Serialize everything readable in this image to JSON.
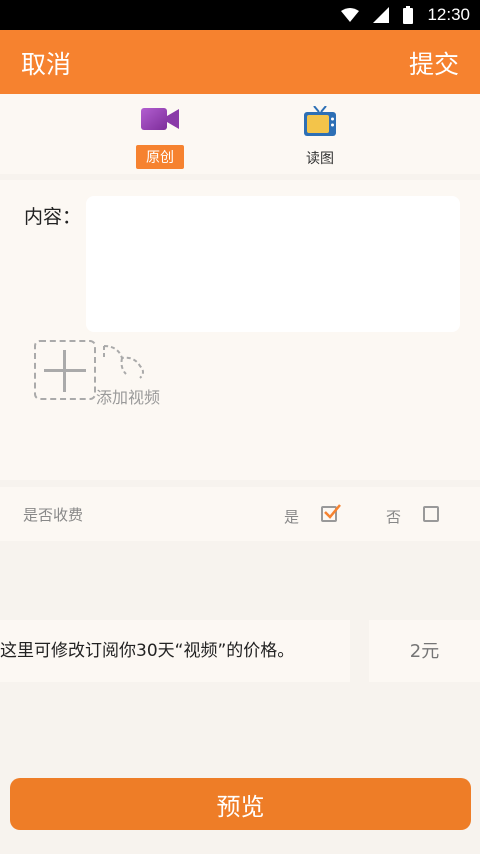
{
  "status_bar": {
    "time": "12:30"
  },
  "header": {
    "cancel_label": "取消",
    "submit_label": "提交"
  },
  "tabs": [
    {
      "label": "原创",
      "icon": "video-camera-icon",
      "selected": true
    },
    {
      "label": "读图",
      "icon": "tv-icon",
      "selected": false
    }
  ],
  "content": {
    "label": "内容：",
    "value": "",
    "add_video_label": "添加视频"
  },
  "charge": {
    "label": "是否收费",
    "yes_label": "是",
    "no_label": "否",
    "yes_checked": true,
    "no_checked": false
  },
  "price": {
    "description": "这里可修改订阅你30天“视频”的价格。",
    "placeholder": "2元"
  },
  "preview_label": "预览",
  "colors": {
    "accent": "#f6822f",
    "background": "#f7f3ee"
  }
}
